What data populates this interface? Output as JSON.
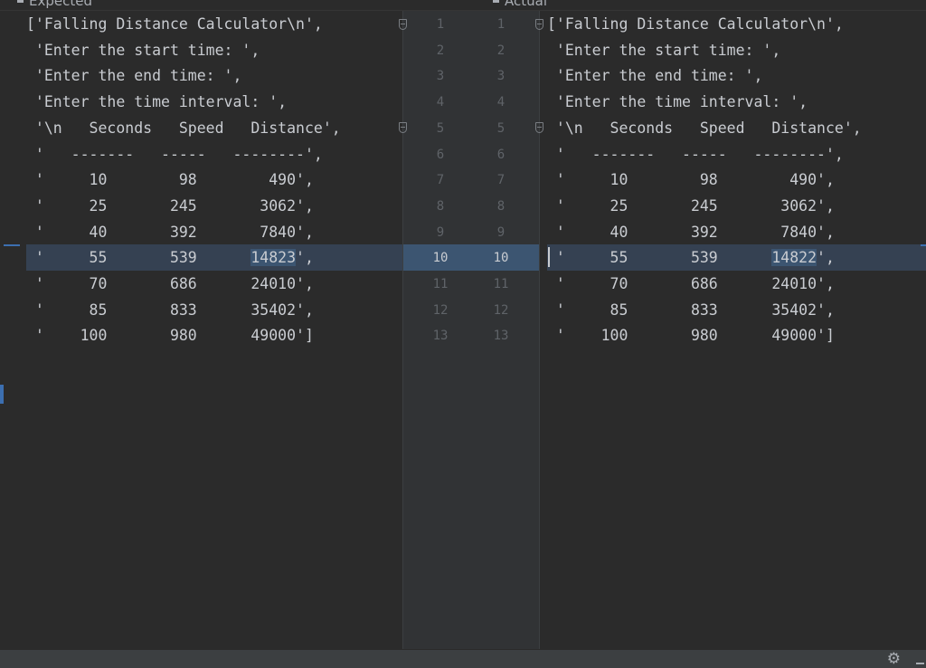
{
  "headers": {
    "expected": "Expected",
    "actual": "Actual"
  },
  "expected_lines": [
    "['Falling Distance Calculator\\n',",
    " 'Enter the start time: ',",
    " 'Enter the end time: ',",
    " 'Enter the time interval: ',",
    " '\\n   Seconds   Speed   Distance',",
    " '   -------   -----   --------',",
    " '     10        98        490',",
    " '     25       245       3062',",
    " '     40       392       7840',",
    " '     55       539      14823',",
    " '     70       686      24010',",
    " '     85       833      35402',",
    " '    100       980      49000']"
  ],
  "actual_lines": [
    "['Falling Distance Calculator\\n',",
    " 'Enter the start time: ',",
    " 'Enter the end time: ',",
    " 'Enter the time interval: ',",
    " '\\n   Seconds   Speed   Distance',",
    " '   -------   -----   --------',",
    " '     10        98        490',",
    " '     25       245       3062',",
    " '     40       392       7840',",
    " '     55       539      14822',",
    " '     70       686      24010',",
    " '     85       833      35402',",
    " '    100       980      49000']"
  ],
  "line_numbers": [
    "1",
    "2",
    "3",
    "4",
    "5",
    "6",
    "7",
    "8",
    "9",
    "10",
    "11",
    "12",
    "13"
  ],
  "current_line": 10,
  "diff": {
    "expected_value": "14823",
    "actual_value": "14822"
  },
  "icons": {
    "settings": "gear-icon",
    "collapse": "minus-icon"
  },
  "colors": {
    "background": "#2b2b2b",
    "highlight": "#3c5571",
    "text": "#c9ccd1"
  }
}
